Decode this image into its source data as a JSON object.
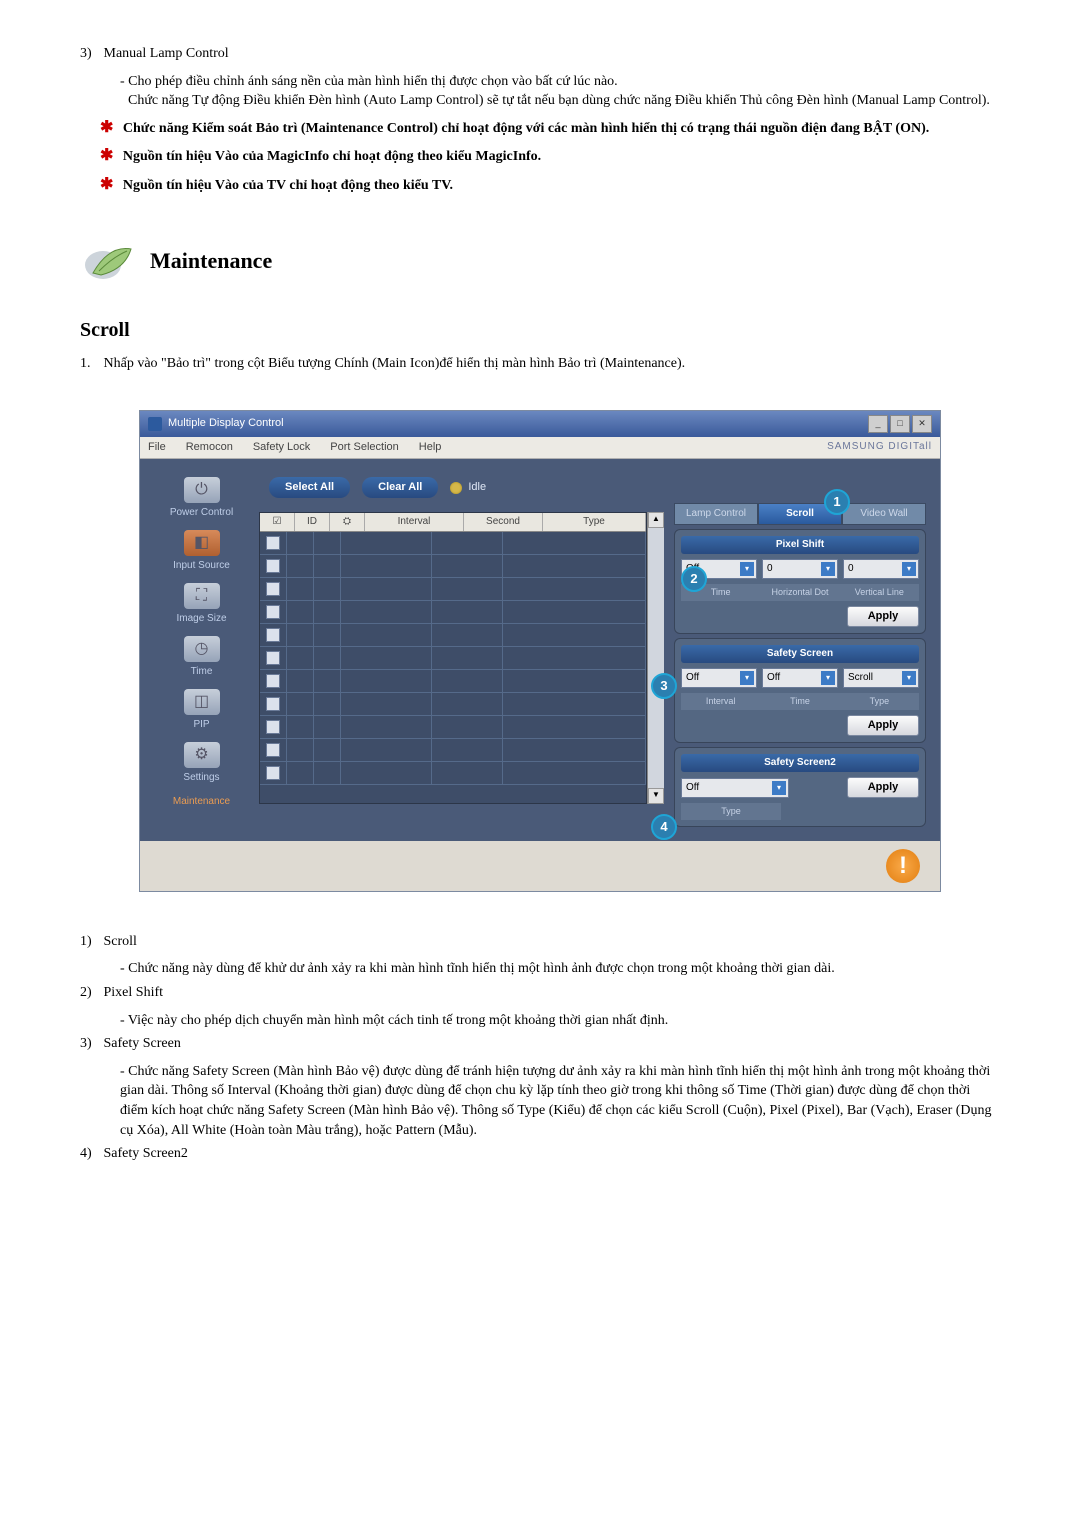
{
  "doc": {
    "item3_num": "3)",
    "item3_label": "Manual Lamp Control",
    "item3_sub1": "- Cho phép điều chỉnh ánh sáng nền của màn hình hiển thị được chọn vào bất cứ lúc nào.",
    "item3_sub2": "Chức năng Tự động Điều khiển Đèn hình (Auto Lamp Control) sẽ tự tắt nếu bạn dùng chức năng Điều khiển Thủ công Đèn hình (Manual Lamp Control).",
    "star1": "Chức năng Kiểm soát Bảo trì (Maintenance Control) chỉ hoạt động với các màn hình hiển thị có trạng thái nguồn điện đang BẬT (ON).",
    "star2": "Nguồn tín hiệu Vào của MagicInfo chỉ hoạt động theo kiểu MagicInfo.",
    "star3": "Nguồn tín hiệu Vào của TV chỉ hoạt động theo kiểu TV.",
    "section_title": "Maintenance",
    "subsection_title": "Scroll",
    "instr1_num": "1.",
    "instr1_text": "Nhấp vào \"Bảo trì\" trong cột Biểu tượng Chính (Main Icon)để hiển thị màn hình Bảo trì (Maintenance).",
    "bottom_1_num": "1)",
    "bottom_1_label": "Scroll",
    "bottom_1_sub": "- Chức năng này dùng để khử dư ảnh xảy ra khi màn hình tĩnh hiển thị một hình ảnh được chọn trong một khoảng thời gian dài.",
    "bottom_2_num": "2)",
    "bottom_2_label": "Pixel Shift",
    "bottom_2_sub": "- Việc này cho phép dịch chuyển màn hình một cách tinh tế trong một khoảng thời gian nhất định.",
    "bottom_3_num": "3)",
    "bottom_3_label": "Safety Screen",
    "bottom_3_sub": "- Chức năng Safety Screen (Màn hình Bảo vệ) được dùng để tránh hiện tượng dư ảnh xảy ra khi màn hình tĩnh hiển thị một hình ảnh trong một khoảng thời gian dài. Thông số Interval (Khoảng thời gian) được dùng để chọn chu kỳ lặp tính theo giờ trong khi thông số Time (Thời gian) được dùng để chọn thời điểm kích hoạt chức năng Safety Screen (Màn hình Bảo vệ). Thông số Type (Kiểu) để chọn các kiểu Scroll (Cuộn), Pixel (Pixel), Bar (Vạch), Eraser (Dụng cụ Xóa), All White (Hoàn toàn Màu trắng), hoặc Pattern (Mẫu).",
    "bottom_4_num": "4)",
    "bottom_4_label": "Safety Screen2"
  },
  "app": {
    "title": "Multiple Display Control",
    "menu": {
      "file": "File",
      "remocon": "Remocon",
      "safety": "Safety Lock",
      "port": "Port Selection",
      "help": "Help"
    },
    "logo": "SAMSUNG DIGITall",
    "toolbar": {
      "select_all": "Select All",
      "clear_all": "Clear All",
      "idle": "Idle"
    },
    "sidebar": {
      "power": "Power Control",
      "input": "Input Source",
      "image": "Image Size",
      "time": "Time",
      "pip": "PIP",
      "settings": "Settings",
      "maintenance": "Maintenance"
    },
    "grid": {
      "chk_hdr": "☑",
      "id": "ID",
      "lamp_hdr": "⛭",
      "interval": "Interval",
      "second": "Second",
      "type": "Type"
    },
    "tabs": {
      "lamp": "Lamp Control",
      "scroll": "Scroll",
      "video": "Video Wall"
    },
    "pixel_shift": {
      "title": "Pixel Shift",
      "off": "Off",
      "v1": "0",
      "v2": "0",
      "l_time": "Time",
      "l_horiz": "Horizontal Dot",
      "l_vert": "Vertical Line",
      "apply": "Apply"
    },
    "safety_screen": {
      "title": "Safety Screen",
      "off1": "Off",
      "off2": "Off",
      "scroll": "Scroll",
      "l_interval": "Interval",
      "l_time": "Time",
      "l_type": "Type",
      "apply": "Apply"
    },
    "safety_screen2": {
      "title": "Safety Screen2",
      "off": "Off",
      "l_type": "Type",
      "apply": "Apply"
    },
    "callouts": {
      "c1": "1",
      "c2": "2",
      "c3": "3",
      "c4": "4"
    }
  }
}
